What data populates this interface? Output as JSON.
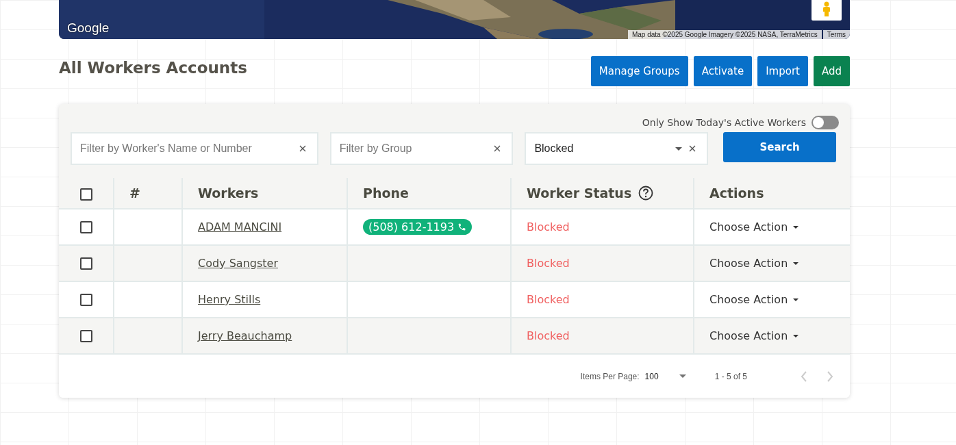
{
  "map": {
    "logo": "Google",
    "attribution": "Map data ©2025 Google Imagery ©2025 NASA, TerraMetrics",
    "terms": "Terms"
  },
  "page_title": "All Workers Accounts",
  "buttons": [
    {
      "label": "Manage Groups",
      "kind": "primary"
    },
    {
      "label": "Activate",
      "kind": "primary"
    },
    {
      "label": "Import",
      "kind": "primary"
    },
    {
      "label": "Add",
      "kind": "success"
    }
  ],
  "active_toggle": {
    "label": "Only Show Today's Active Workers",
    "on": false
  },
  "filters": {
    "name": {
      "placeholder": "Filter by Worker's Name or Number"
    },
    "group": {
      "placeholder": "Filter by Group"
    },
    "status": {
      "value": "Blocked"
    },
    "search_button": "Search"
  },
  "table": {
    "columns": [
      "#",
      "Workers",
      "Phone",
      "Worker Status",
      "Actions"
    ],
    "all_checked": false,
    "rows": [
      {
        "checked": false,
        "worker": "ADAM MANCINI",
        "phone": "(508) 612-1193",
        "status": "Blocked",
        "action": "Choose Action"
      },
      {
        "checked": false,
        "worker": "Cody Sangster",
        "status": "Blocked",
        "action": "Choose Action"
      },
      {
        "checked": false,
        "worker": "Henry Stills",
        "status": "Blocked",
        "action": "Choose Action"
      },
      {
        "checked": false,
        "worker": "Jerry Beauchamp",
        "status": "Blocked",
        "action": "Choose Action"
      }
    ]
  },
  "pagination": {
    "items_per_page_label": "Items Per Page:",
    "items_per_page": "100",
    "range": "1 - 5 of 5"
  }
}
